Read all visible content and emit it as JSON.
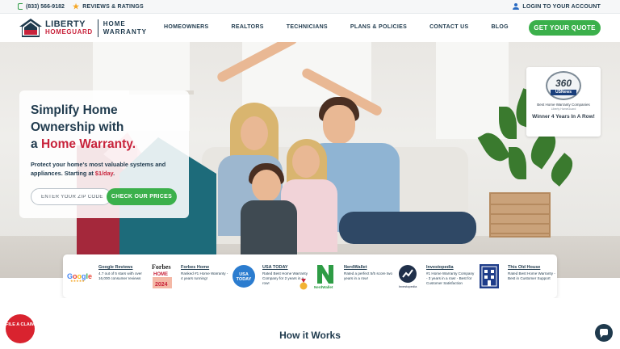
{
  "topbar": {
    "phone": "(833) 566-9182",
    "reviews": "REVIEWS & RATINGS",
    "login": "LOGIN TO YOUR ACCOUNT"
  },
  "header": {
    "logo_line1": "LIBERTY",
    "logo_line2": "HOMEGUARD",
    "logo_sub1": "HOME",
    "logo_sub2": "WARRANTY",
    "nav": [
      "HOMEOWNERS",
      "REALTORS",
      "TECHNICIANS",
      "PLANS & POLICIES",
      "CONTACT US",
      "BLOG"
    ],
    "cta": "GET YOUR QUOTE"
  },
  "hero": {
    "title_l1": "Simplify Home",
    "title_l2": "Ownership with",
    "title_l3_prefix": "a ",
    "title_l3_accent": "Home Warranty.",
    "text_main": "Protect your home's most valuable systems and appliances. Starting at ",
    "text_price": "$1/day",
    "text_end": ".",
    "zip_placeholder": "ENTER YOUR ZIP CODE",
    "cta": "CHECK OUR PRICES"
  },
  "award": {
    "seal_number": "360",
    "seal_brand": "USNews",
    "line1": "Best Home Warranty Companies",
    "line2": "Liberty HomeGuard",
    "caption": "Winner 4 Years In A Row!"
  },
  "reviews": [
    {
      "logo": "Google",
      "name": "Google Reviews",
      "desc": "4.7 out of 5 stars with over 16,000 consumer reviews"
    },
    {
      "logo": "Forbes",
      "name": "Forbes Home",
      "desc": "Ranked #1 Home Warranty - 4 years running!"
    },
    {
      "logo": "USA TODAY",
      "name": "USA TODAY",
      "desc": "Rated Best Home Warranty Company for 2 years in a row!"
    },
    {
      "logo": "NerdWallet",
      "name": "NerdWallet",
      "desc": "Rated a perfect 5/5 score two years in a row!"
    },
    {
      "logo": "Investopedia",
      "name": "Investopedia",
      "desc": "#1 Home Warranty Company - 3 years in a row! - Best for Customer Satisfaction"
    },
    {
      "logo": "This Old House",
      "name": "This Old House",
      "desc": "Rated Best Home Warranty - Best in Customer Support"
    }
  ],
  "forbes_badge": {
    "brand": "Forbes",
    "line1": "HOME",
    "year": "2024"
  },
  "how_it_works": "How it Works",
  "file_claim": "FILE A CLAIM",
  "colors": {
    "brand_navy": "#1f3a4d",
    "brand_red": "#c8233b",
    "cta_green": "#3bb04b",
    "claim_red": "#d9232f"
  }
}
